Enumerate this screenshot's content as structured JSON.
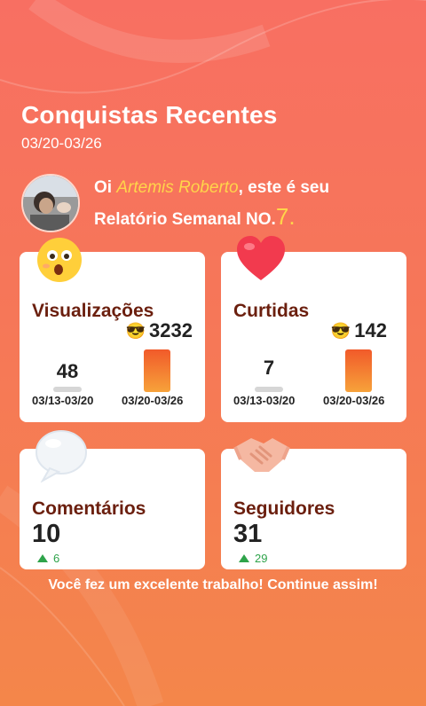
{
  "header": {
    "title": "Conquistas Recentes",
    "date_range": "03/20-03/26"
  },
  "greeting": {
    "prefix": "Oi ",
    "name": "Artemis Roberto",
    "middle": ", este é seu",
    "line2": "Relatório Semanal NO.",
    "number": "7",
    "suffix": "."
  },
  "cards": {
    "views": {
      "icon": "surprised-face-icon",
      "title": "Visualizações",
      "total": "3232",
      "prev_value": "48",
      "prev_range": "03/13-03/20",
      "cur_range": "03/20-03/26"
    },
    "likes": {
      "icon": "heart-icon",
      "title": "Curtidas",
      "total": "142",
      "prev_value": "7",
      "prev_range": "03/13-03/20",
      "cur_range": "03/20-03/26"
    },
    "comments": {
      "icon": "speech-bubble-icon",
      "title": "Comentários",
      "value": "10",
      "delta": "6"
    },
    "followers": {
      "icon": "handshake-icon",
      "title": "Seguidores",
      "value": "31",
      "delta": "29"
    }
  },
  "footer": {
    "message": "Você fez um excelente trabalho! Continue assim!"
  },
  "colors": {
    "accent_yellow": "#ffd54a",
    "title_brown": "#6b1f0e",
    "growth_green": "#2ea34a"
  }
}
